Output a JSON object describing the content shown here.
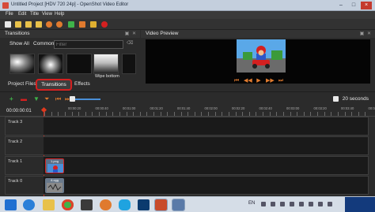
{
  "window": {
    "title": "Untitled Project [HDV 720 24p] - OpenShot Video Editor",
    "controls": {
      "minimize": "–",
      "maximize": "□",
      "close": "×"
    }
  },
  "menu": [
    "File",
    "Edit",
    "Title",
    "View",
    "Help"
  ],
  "toolbar": {
    "icons": [
      "new-project-icon",
      "open-project-icon",
      "save-project-icon",
      "save-as-icon",
      "undo-icon",
      "redo-icon",
      "import-files-icon",
      "profile-icon",
      "fullscreen-icon",
      "export-video-icon"
    ]
  },
  "transitions_panel": {
    "title": "Transitions",
    "filters": {
      "show_all": "Show All",
      "common": "Common"
    },
    "filter_placeholder": "Filter",
    "items": [
      {
        "label": ""
      },
      {
        "label": ""
      },
      {
        "label": ""
      },
      {
        "label": "Wipe bottom"
      },
      {
        "label": ""
      }
    ]
  },
  "tabs": {
    "project_files": "Project Files",
    "transitions": "Transitions",
    "effects": "Effects",
    "active": "transitions"
  },
  "video_preview": {
    "title": "Video Preview",
    "controls": [
      "jump-to-start",
      "rewind",
      "play",
      "fast-forward",
      "jump-to-end"
    ]
  },
  "timeline": {
    "zoom_label": "20 seconds",
    "zoom_level": 0.05,
    "current_time": "00:00:00:01",
    "ruler_labels": [
      "00:00:20",
      "00:00:40",
      "00:01:00",
      "00:01:20",
      "00:01:40",
      "00:02:00",
      "00:02:20",
      "00:02:40",
      "00:03:00",
      "00:03:20",
      "00:03:40",
      "00:04:00"
    ],
    "tracks": [
      {
        "name": "Track 3",
        "clip": null
      },
      {
        "name": "Track 2",
        "clip": null
      },
      {
        "name": "Track 1",
        "clip": "1.png",
        "highlighted": true
      },
      {
        "name": "Track 0",
        "clip": "4.ogg",
        "highlighted": false
      }
    ]
  },
  "taskbar": {
    "apps": [
      "start-icon",
      "internet-explorer-icon",
      "file-explorer-icon",
      "chrome-icon",
      "media-player-icon",
      "firefox-icon",
      "skype-icon",
      "photoshop-icon",
      "powerpoint-icon",
      "openshot-icon"
    ],
    "tray": {
      "language": "EN"
    }
  },
  "colors": {
    "accent_highlight": "#d42020",
    "timeline_controls": "#e07a2e",
    "playhead": "#d02a1a",
    "clip": "#5b6e86",
    "taskbar": "#d5dde7"
  }
}
